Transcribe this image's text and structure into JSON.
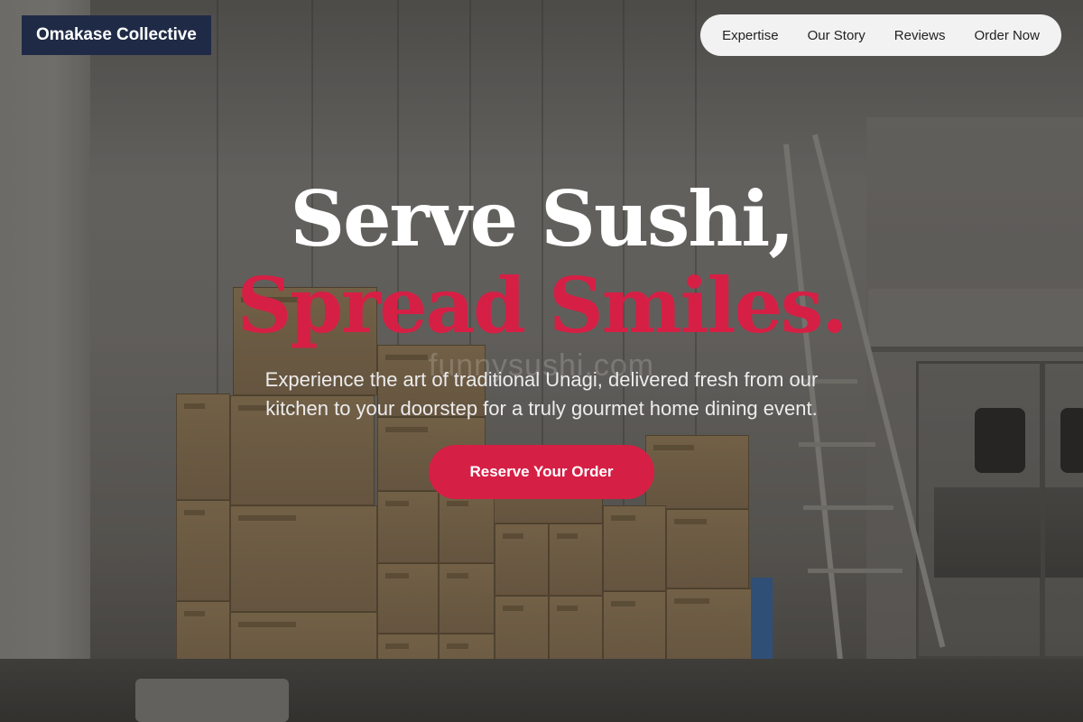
{
  "header": {
    "brand": "Omakase Collective",
    "nav": [
      {
        "label": "Expertise"
      },
      {
        "label": "Our Story"
      },
      {
        "label": "Reviews"
      },
      {
        "label": "Order Now"
      }
    ]
  },
  "hero": {
    "title_line1": "Serve Sushi,",
    "title_line2": "Spread Smiles.",
    "subtitle": "Experience the art of traditional Unagi, delivered fresh from our kitchen to your doorstep for a truly gourmet home dining event.",
    "cta_label": "Reserve Your Order",
    "watermark": "funnysushi.com"
  },
  "colors": {
    "accent": "#d61f45",
    "brand_bg": "#1f2b46",
    "nav_bg": "#f2f2f2"
  },
  "background": {
    "description_icon": "warehouse-photo"
  }
}
